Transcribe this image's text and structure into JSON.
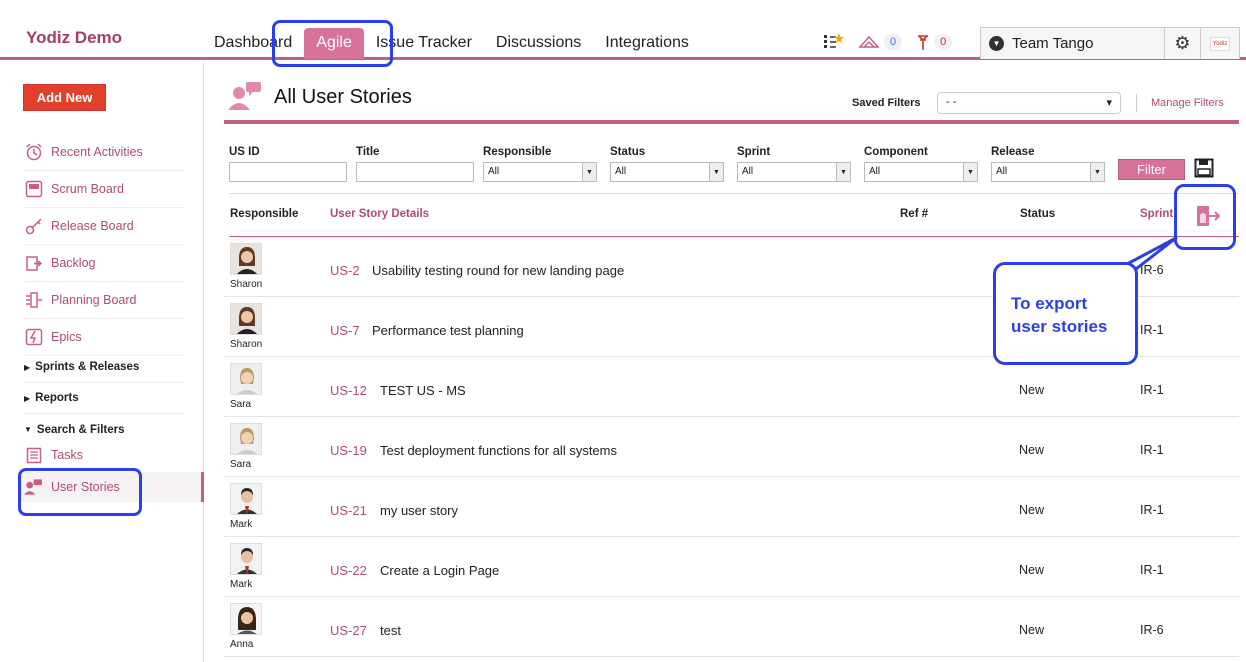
{
  "brand": "Yodiz Demo",
  "nav": {
    "tabs": [
      {
        "label": "Dashboard"
      },
      {
        "label": "Agile"
      },
      {
        "label": "Issue Tracker"
      },
      {
        "label": "Discussions"
      },
      {
        "label": "Integrations"
      }
    ],
    "active_tab": "Agile"
  },
  "status": {
    "notifications_count": "0",
    "alerts_count": "0"
  },
  "team": {
    "selected": "Team Tango",
    "logo_text": "Yodiz"
  },
  "sidebar": {
    "add_new": "Add New",
    "items": [
      {
        "label": "Recent Activities",
        "icon": "alarm-clock-icon"
      },
      {
        "label": "Scrum Board",
        "icon": "board-icon"
      },
      {
        "label": "Release Board",
        "icon": "key-icon"
      },
      {
        "label": "Backlog",
        "icon": "backlog-icon"
      },
      {
        "label": "Planning Board",
        "icon": "planning-icon"
      },
      {
        "label": "Epics",
        "icon": "epic-icon"
      }
    ],
    "sections": [
      {
        "label": "Sprints & Releases"
      },
      {
        "label": "Reports"
      },
      {
        "label": "Search & Filters"
      }
    ],
    "sub_items": [
      {
        "label": "Tasks"
      },
      {
        "label": "User Stories"
      }
    ]
  },
  "page": {
    "title": "All User Stories",
    "saved_filters_label": "Saved Filters",
    "saved_filters_value": "- -",
    "manage_filters": "Manage Filters"
  },
  "filters": {
    "us_id_label": "US ID",
    "title_label": "Title",
    "responsible_label": "Responsible",
    "responsible_value": "All",
    "status_label": "Status",
    "status_value": "All",
    "sprint_label": "Sprint",
    "sprint_value": "All",
    "component_label": "Component",
    "component_value": "All",
    "release_label": "Release",
    "release_value": "All",
    "filter_button": "Filter"
  },
  "table": {
    "headers": {
      "responsible": "Responsible",
      "details": "User Story Details",
      "ref": "Ref #",
      "status": "Status",
      "sprint": "Sprint"
    },
    "rows": [
      {
        "user": "Sharon",
        "id": "US-2",
        "title": "Usability testing round for new landing page",
        "status": "",
        "sprint": "IR-6"
      },
      {
        "user": "Sharon",
        "id": "US-7",
        "title": "Performance test planning",
        "status": "",
        "sprint": "IR-1"
      },
      {
        "user": "Sara",
        "id": "US-12",
        "title": "TEST US - MS",
        "status": "New",
        "sprint": "IR-1"
      },
      {
        "user": "Sara",
        "id": "US-19",
        "title": "Test deployment functions for all systems",
        "status": "New",
        "sprint": "IR-1"
      },
      {
        "user": "Mark",
        "id": "US-21",
        "title": "my user story",
        "status": "New",
        "sprint": "IR-1"
      },
      {
        "user": "Mark",
        "id": "US-22",
        "title": "Create a Login Page",
        "status": "New",
        "sprint": "IR-1"
      },
      {
        "user": "Anna",
        "id": "US-27",
        "title": "test",
        "status": "New",
        "sprint": "IR-6"
      }
    ]
  },
  "callout": {
    "line1": "To export",
    "line2": "user stories"
  },
  "colors": {
    "accent": "#c0607f",
    "highlight": "#2c3fe6",
    "add_button": "#e1412b"
  }
}
